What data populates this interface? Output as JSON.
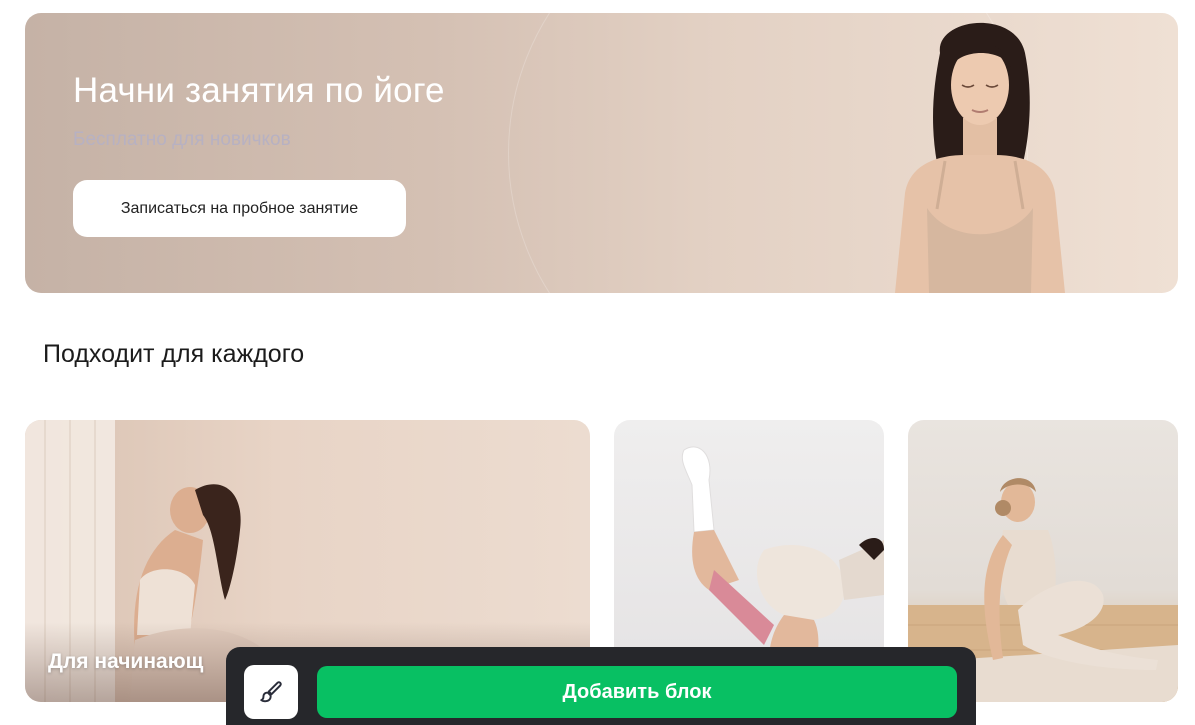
{
  "hero": {
    "title": "Начни занятия по йоге",
    "subtitle": "Бесплатно для новичков",
    "cta_label": "Записаться на пробное занятие"
  },
  "section": {
    "title": "Подходит для каждого"
  },
  "cards": [
    {
      "label": "Для начинающ"
    },
    {
      "label": ""
    },
    {
      "label": ""
    }
  ],
  "toolbar": {
    "brush_icon": "paintbrush-icon",
    "add_block_label": "Добавить блок"
  },
  "colors": {
    "accent_green": "#08c063",
    "toolbar_bg": "#26272b",
    "hero_subtitle": "#b7b1c2"
  }
}
